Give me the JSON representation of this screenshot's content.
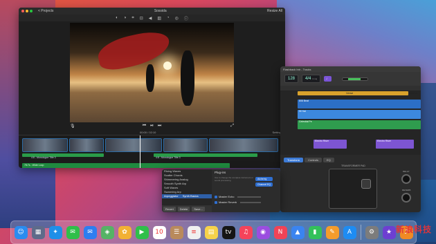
{
  "imovie": {
    "title": "Sossida",
    "back_label": "< Projects",
    "export_label": "Resize All",
    "timecode": "00:00 / 02:10",
    "settings_label": "Settings",
    "clip_labels": [
      "4:8 - Monologue Title 3",
      "4:8 - Monologue Title 3"
    ],
    "music_label": "78:7s - Wide Loop"
  },
  "garageband": {
    "title": "Flashback Intr - Tracks",
    "tempo": "128",
    "tempo_label": "Tempo",
    "time_sig": "4/4",
    "key": "Cmaj",
    "regions": [
      "Verse",
      "Chorus"
    ],
    "track_names": [
      "808 Beat",
      "Hi Hat",
      "Celestial Pe",
      "Electro Riser",
      "Electro Riser"
    ],
    "tabs": [
      "Transform",
      "Controls",
      "EQ"
    ],
    "transform_title": "TRANSFORMER PAD",
    "knob_labels": [
      "DELAY",
      "REVERB"
    ]
  },
  "synth": {
    "presets": [
      "Rising Waves",
      "Scatter Chords",
      "Shimmering Analog",
      "Smooth Synth Arp",
      "Soft Waves",
      "Swarming Arp"
    ],
    "selected_index": 1,
    "category": "Arpeggiator",
    "subcategory": "Synth Basics",
    "buttons": [
      "Revert",
      "Delete",
      "Save..."
    ],
    "plugins_label": "Plug-ins",
    "plugin_desc": "Use to change the complete instrument or sound processing",
    "plugin_buttons": [
      "Alchemy",
      "Channel EQ"
    ],
    "checks": [
      "Master Echo",
      "Master Reverb"
    ]
  },
  "dock": {
    "apps": [
      {
        "name": "finder",
        "glyph": "☺",
        "color": "#2a8cf0"
      },
      {
        "name": "launchpad",
        "glyph": "▦",
        "color": "#5e6b8a"
      },
      {
        "name": "safari",
        "glyph": "✦",
        "color": "#1f8fe8"
      },
      {
        "name": "messages",
        "glyph": "✉",
        "color": "#2fbf4a"
      },
      {
        "name": "mail",
        "glyph": "✉",
        "color": "#2d7ef0"
      },
      {
        "name": "maps",
        "glyph": "◈",
        "color": "#55b365"
      },
      {
        "name": "photos",
        "glyph": "✿",
        "color": "#f2b134"
      },
      {
        "name": "facetime",
        "glyph": "▶",
        "color": "#2fbf4a"
      },
      {
        "name": "calendar",
        "glyph": "10",
        "color": "#ffffff"
      },
      {
        "name": "contacts",
        "glyph": "☰",
        "color": "#b98a5c"
      },
      {
        "name": "reminders",
        "glyph": "≡",
        "color": "#f0f0f0"
      },
      {
        "name": "notes",
        "glyph": "▤",
        "color": "#f6d24a"
      },
      {
        "name": "tv",
        "glyph": "tv",
        "color": "#151515"
      },
      {
        "name": "music",
        "glyph": "♫",
        "color": "#f5435a"
      },
      {
        "name": "podcasts",
        "glyph": "◉",
        "color": "#9b4de0"
      },
      {
        "name": "news",
        "glyph": "N",
        "color": "#f14356"
      },
      {
        "name": "keynote",
        "glyph": "▲",
        "color": "#3a84f0"
      },
      {
        "name": "numbers",
        "glyph": "▮",
        "color": "#33c15a"
      },
      {
        "name": "pages",
        "glyph": "✎",
        "color": "#f49c2c"
      },
      {
        "name": "app-store",
        "glyph": "A",
        "color": "#1e8cf2"
      },
      {
        "name": "system-preferences",
        "glyph": "⚙",
        "color": "#7c7c7c"
      },
      {
        "name": "imovie",
        "glyph": "★",
        "color": "#6d3fd1"
      },
      {
        "name": "garageband",
        "glyph": "♪",
        "color": "#f08a24"
      }
    ]
  },
  "watermark": "新浪科技"
}
